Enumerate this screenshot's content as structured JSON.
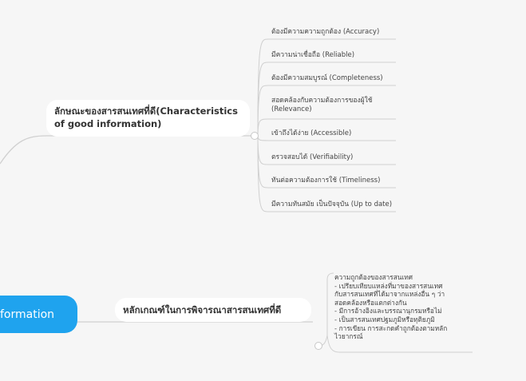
{
  "root": {
    "label": "formation"
  },
  "branches": [
    {
      "label": "ลักษณะของสารสนเทศที่ดี(Characteristics of good information)",
      "children": [
        "ต้องมีความความถูกต้อง (Accuracy)",
        "มีความน่าเชื่อถือ (Reliable)",
        "ต้องมีความสมบูรณ์ (Completeness)",
        "สอดคล้องกับความต้องการของผู้ใช้ (Relevance)",
        "เข้าถึงได้ง่าย (Accessible)",
        "ตรวจสอบได้ (Verifiability)",
        "ทันต่อความต้องการใช้ (Timeliness)",
        "มีความทันสมัย เป็นปัจจุบัน (Up to date)"
      ]
    },
    {
      "label": "หลักเกณฑ์ในการพิจารณาสารสนเทศที่ดี",
      "note": [
        "ความถูกต้องของสารสนเทศ",
        "- เปรียบเทียบแหล่งที่มาของสารสนเทศ",
        "กับสารสนเทศที่ได้มาจากแหล่งอื่น ๆ ว่า",
        "สอดคล้องหรือแตกต่างกัน",
        "- มีการอ้างอิงและบรรณานุกรมหรือไม่",
        "- เป็นสารสนเทศปฐมภูมิหรือทุติยภูมิ",
        "- การเขียน การสะกดคำถูกต้องตามหลัก",
        "ไวยากรณ์"
      ]
    }
  ]
}
